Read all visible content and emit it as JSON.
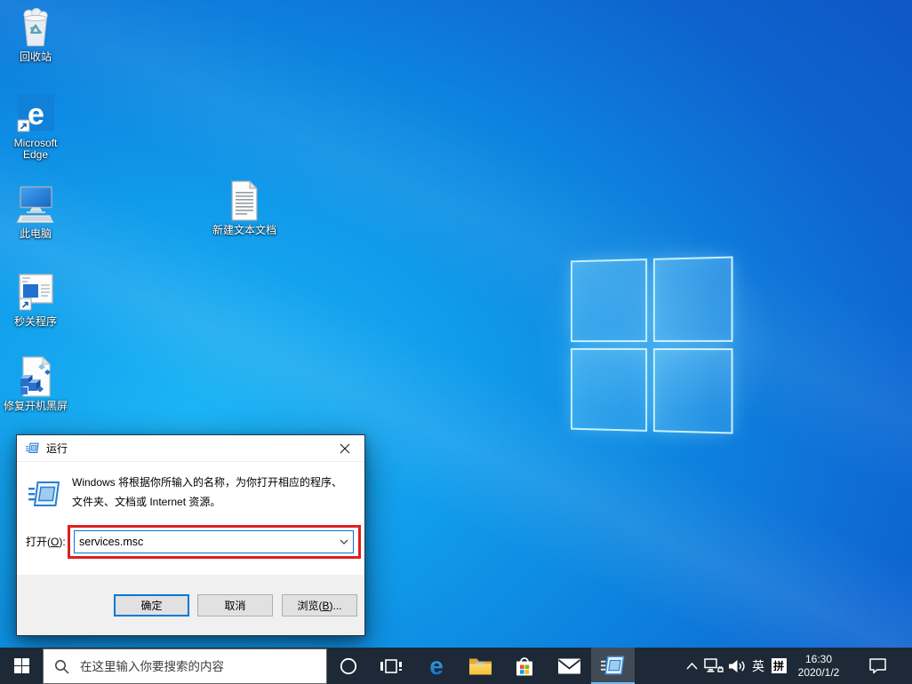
{
  "desktop_icons": [
    {
      "label": "回收站"
    },
    {
      "label": "Microsoft Edge"
    },
    {
      "label": "此电脑"
    },
    {
      "label": "秒关程序"
    },
    {
      "label": "修复开机黑屏"
    },
    {
      "label": "新建文本文档"
    }
  ],
  "icons": {
    "edge_glyph": "e"
  },
  "run_dialog": {
    "title": "运行",
    "description_line1": "Windows 将根据你所输入的名称，为你打开相应的程序、",
    "description_line2": "文件夹、文档或 Internet 资源。",
    "open_label_pre": "打开(",
    "open_label_key": "O",
    "open_label_post": "):",
    "input_value": "services.msc",
    "ok_label": "确定",
    "cancel_label": "取消",
    "browse_label_pre": "浏览(",
    "browse_label_key": "B",
    "browse_label_post": ")..."
  },
  "taskbar": {
    "search_placeholder": "在这里输入你要搜索的内容",
    "tray": {
      "language": "英",
      "ime_mode": "拼",
      "time": "16:30",
      "date": "2020/1/2"
    }
  },
  "colors": {
    "taskbar_bg": "#1d2936",
    "accent": "#0078d7",
    "annotation_red": "#e01e1e",
    "active_underline": "#76b9ed"
  }
}
